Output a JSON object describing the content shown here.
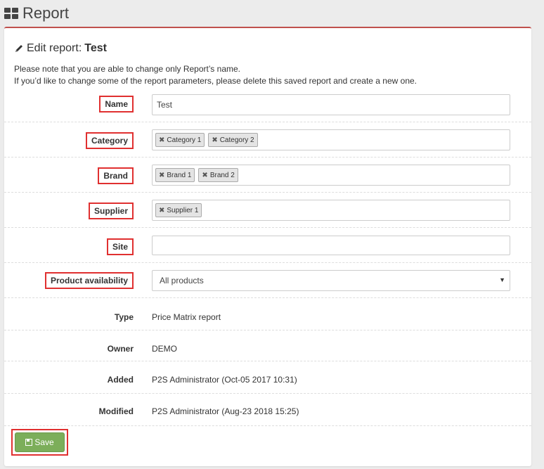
{
  "page": {
    "title": "Report",
    "icon": "grid-icon"
  },
  "panel": {
    "heading_prefix": "Edit report:",
    "heading_name": "Test",
    "note_line1": "Please note that you are able to change only Report’s name.",
    "note_line2": "If you’d like to change some of the report parameters, please delete this saved report and create a new one."
  },
  "form": {
    "name": {
      "label": "Name",
      "value": "Test"
    },
    "category": {
      "label": "Category",
      "tags": [
        "Category 1",
        "Category 2"
      ]
    },
    "brand": {
      "label": "Brand",
      "tags": [
        "Brand 1",
        "Brand 2"
      ]
    },
    "supplier": {
      "label": "Supplier",
      "tags": [
        "Supplier 1"
      ]
    },
    "site": {
      "label": "Site",
      "value": ""
    },
    "availability": {
      "label": "Product availability",
      "selected": "All products"
    }
  },
  "info": {
    "type": {
      "label": "Type",
      "value": "Price Matrix report"
    },
    "owner": {
      "label": "Owner",
      "value": "DEMO"
    },
    "added": {
      "label": "Added",
      "value": "P2S Administrator (Oct-05 2017 10:31)"
    },
    "modified": {
      "label": "Modified",
      "value": "P2S Administrator (Aug-23 2018 15:25)"
    }
  },
  "actions": {
    "save_label": "Save"
  },
  "colors": {
    "accent": "#c0504d",
    "highlight": "#e03030",
    "save": "#7cae5a"
  }
}
